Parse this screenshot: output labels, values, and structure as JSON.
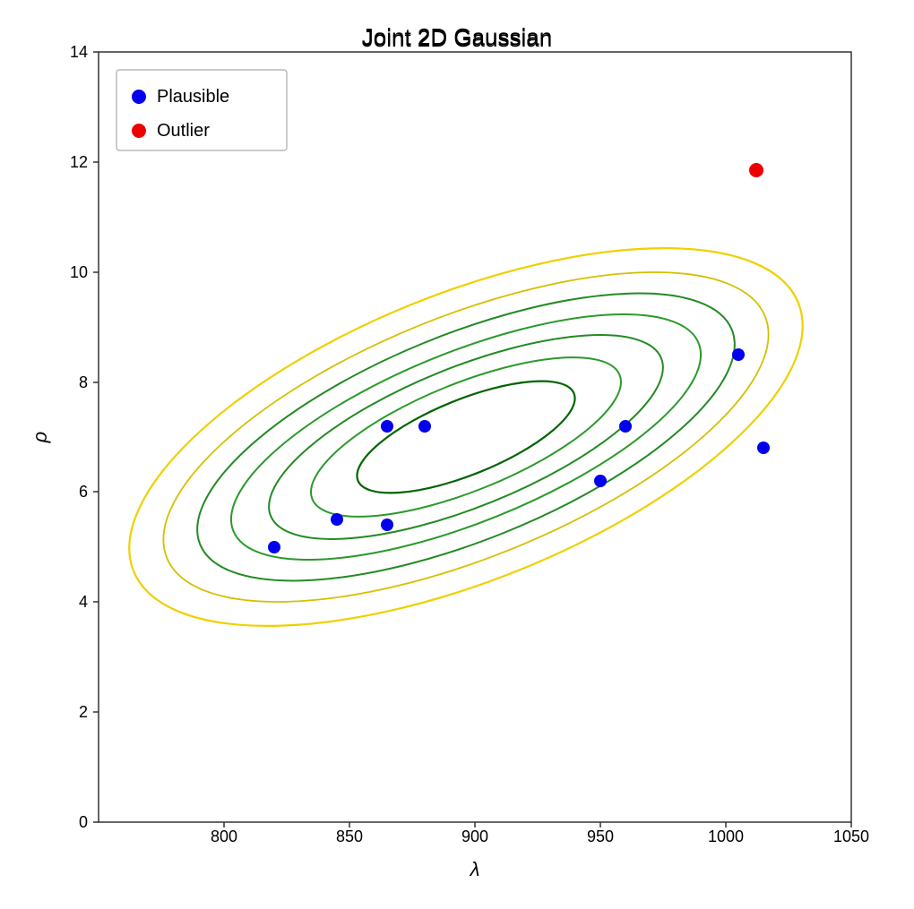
{
  "chart": {
    "title": "Joint 2D Gaussian",
    "x_axis_label": "λ",
    "y_axis_label": "ρ",
    "x_min": 750,
    "x_max": 1050,
    "y_min": 0,
    "y_max": 14,
    "x_ticks": [
      800,
      850,
      900,
      950,
      1000,
      1050
    ],
    "y_ticks": [
      0,
      2,
      4,
      6,
      8,
      10,
      12,
      14
    ],
    "legend": {
      "items": [
        {
          "label": "Plausible",
          "color": "#0000cc"
        },
        {
          "label": "Outlier",
          "color": "#cc0000"
        }
      ]
    },
    "blue_points": [
      {
        "x": 820,
        "y": 5.0
      },
      {
        "x": 845,
        "y": 5.5
      },
      {
        "x": 865,
        "y": 7.2
      },
      {
        "x": 880,
        "y": 7.2
      },
      {
        "x": 865,
        "y": 5.4
      },
      {
        "x": 950,
        "y": 6.2
      },
      {
        "x": 960,
        "y": 7.2
      },
      {
        "x": 1005,
        "y": 8.5
      },
      {
        "x": 1015,
        "y": 6.8
      }
    ],
    "red_points": [
      {
        "x": 1012,
        "y": 11.85
      }
    ]
  }
}
